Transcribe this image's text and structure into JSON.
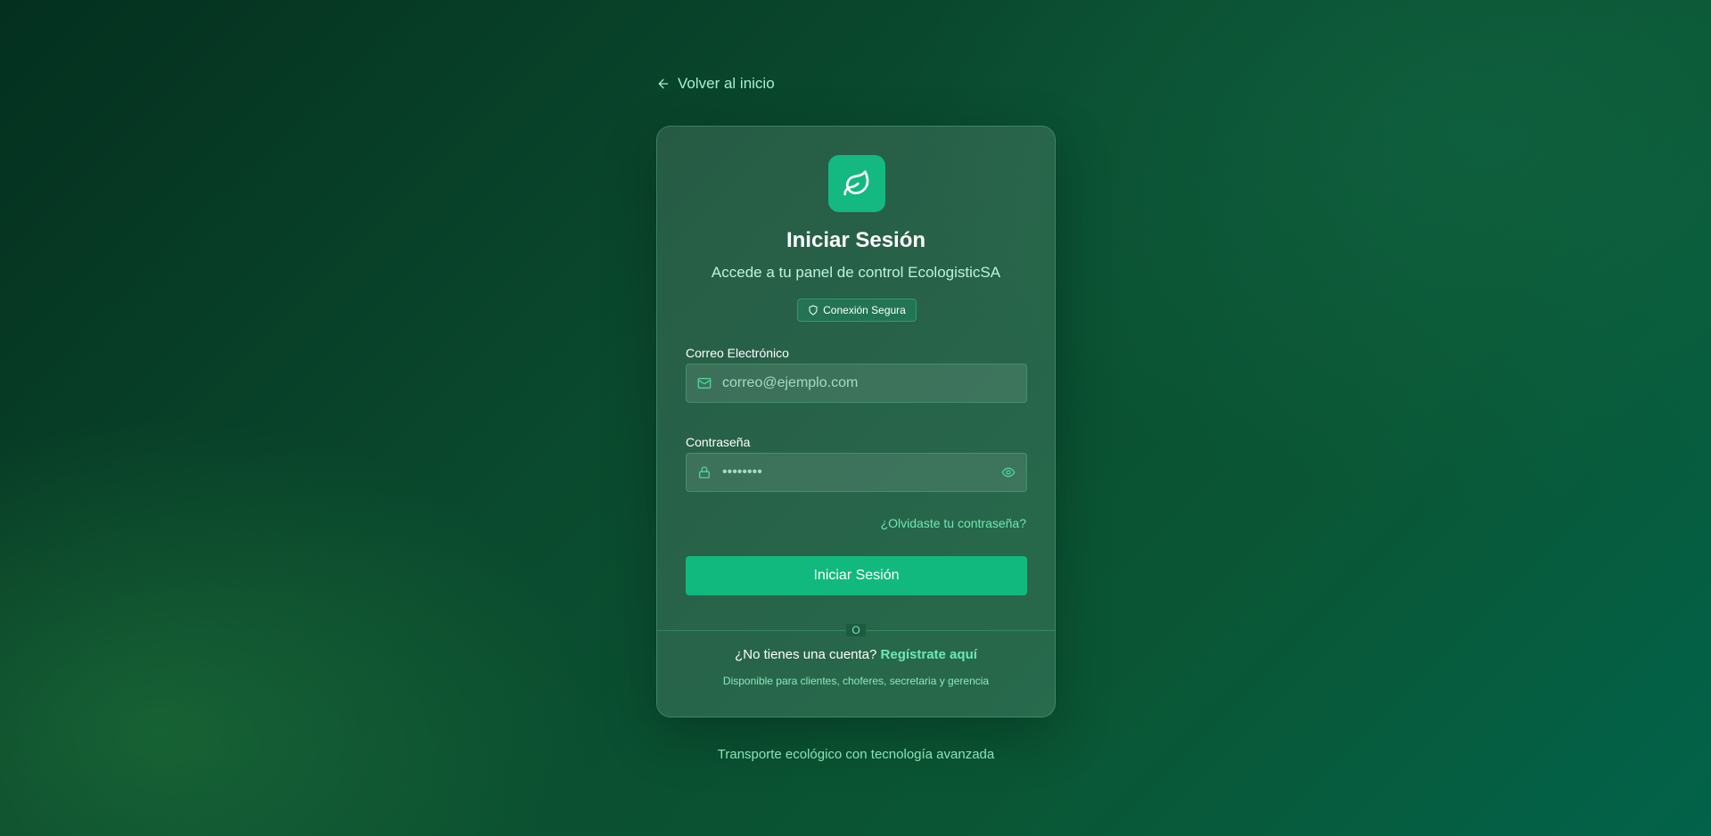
{
  "back_link": {
    "label": "Volver al inicio",
    "icon": "arrow-left-icon"
  },
  "card": {
    "logo_icon": "leaf-icon",
    "title": "Iniciar Sesión",
    "subtitle": "Accede a tu panel de control EcologisticSA",
    "badge": {
      "label": "Conexión Segura",
      "icon": "shield-icon"
    },
    "email": {
      "label": "Correo Electrónico",
      "placeholder": "correo@ejemplo.com",
      "value": "",
      "icon": "mail-icon"
    },
    "password": {
      "label": "Contraseña",
      "placeholder": "••••••••",
      "value": "",
      "icon": "lock-icon",
      "toggle_icon": "eye-icon"
    },
    "forgot_label": "¿Olvidaste tu contraseña?",
    "submit_label": "Iniciar Sesión",
    "divider_label": "O",
    "signup": {
      "prompt": "¿No tienes una cuenta?",
      "link_label": "Regístrate aquí"
    },
    "availability": "Disponible para clientes, choferes, secretaria y gerencia"
  },
  "footer": {
    "tagline": "Transporte ecológico con tecnología avanzada"
  },
  "colors": {
    "accent": "#12b97f",
    "link": "#6ee9b4"
  }
}
